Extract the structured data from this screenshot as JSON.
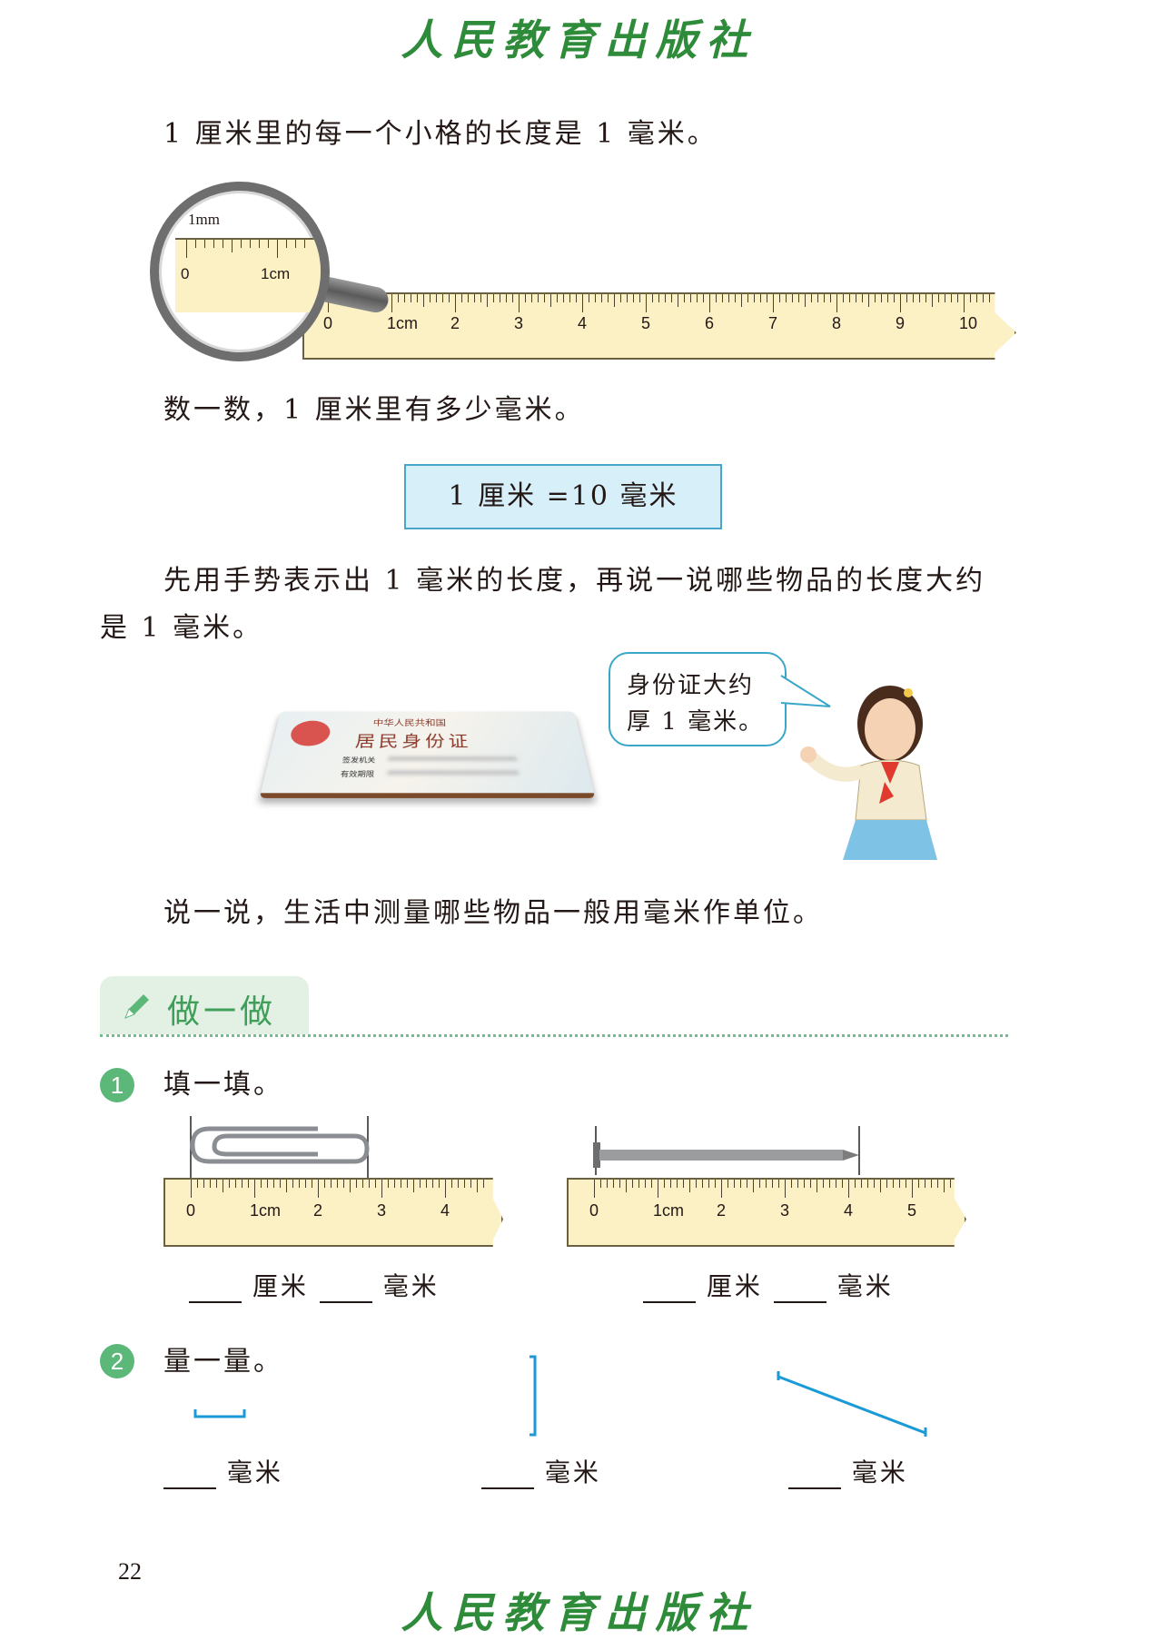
{
  "header": {
    "publisher_logo": "人民教育出版社"
  },
  "intro": {
    "text": "1 厘米里的每一个小格的长度是 1 毫米。"
  },
  "magnifier": {
    "label_mm": "1mm",
    "label_0": "0",
    "label_1cm": "1cm"
  },
  "main_ruler": {
    "labels": [
      "0",
      "1cm",
      "2",
      "3",
      "4",
      "5",
      "6",
      "7",
      "8",
      "9",
      "10"
    ]
  },
  "count": {
    "text": "数一数，1 厘米里有多少毫米。"
  },
  "formula": {
    "text": "1 厘米 =10 毫米"
  },
  "gesture": {
    "line1": "先用手势表示出 1 毫米的长度，再说一说哪些物品的长度大约",
    "line2": "是 1 毫米。"
  },
  "id_card": {
    "title1": "中华人民共和国",
    "title2": "居民身份证",
    "field1": "签发机关",
    "field2": "有效期限"
  },
  "speech": {
    "line1": "身份证大约",
    "line2": "厚 1 毫米。"
  },
  "say": {
    "text": "说一说，生活中测量哪些物品一般用毫米作单位。"
  },
  "section": {
    "title": "做一做"
  },
  "exercise1": {
    "number": "1",
    "title": "填一填。",
    "ruler_a_labels": [
      "0",
      "1cm",
      "2",
      "3",
      "4"
    ],
    "ruler_b_labels": [
      "0",
      "1cm",
      "2",
      "3",
      "4",
      "5"
    ],
    "unit_cm": "厘米",
    "unit_mm": "毫米"
  },
  "exercise2": {
    "number": "2",
    "title": "量一量。",
    "unit_mm": "毫米"
  },
  "footer": {
    "page_number": "22",
    "publisher_logo": "人民教育出版社"
  },
  "colors": {
    "green": "#2e8b3a",
    "badge": "#5cb878",
    "formula_bg": "#d6eff9",
    "ruler": "#fbf1c4",
    "blue_segment": "#1a9ad6"
  }
}
